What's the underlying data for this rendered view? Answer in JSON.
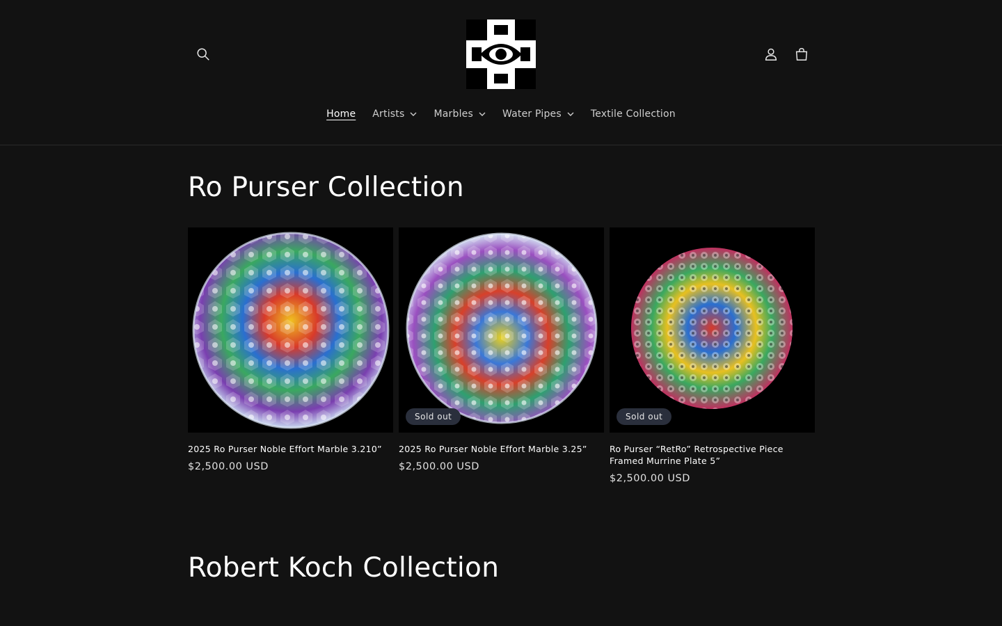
{
  "header": {
    "nav": [
      {
        "label": "Home",
        "active": true,
        "dropdown": false
      },
      {
        "label": "Artists",
        "active": false,
        "dropdown": true
      },
      {
        "label": "Marbles",
        "active": false,
        "dropdown": true
      },
      {
        "label": "Water Pipes",
        "active": false,
        "dropdown": true
      },
      {
        "label": "Textile Collection",
        "active": false,
        "dropdown": false
      }
    ],
    "icons": {
      "search": "search-icon",
      "account": "account-icon",
      "cart": "cart-icon",
      "logo": "eye-logo"
    }
  },
  "sections": [
    {
      "title": "Ro Purser Collection",
      "products": [
        {
          "title": "2025 Ro Purser Noble Effort Marble 3.210”",
          "price": "$2,500.00 USD",
          "sold_out": false,
          "badge": ""
        },
        {
          "title": "2025 Ro Purser Noble Effort Marble 3.25”",
          "price": "$2,500.00 USD",
          "sold_out": true,
          "badge": "Sold out"
        },
        {
          "title": "Ro Purser “RetRo” Retrospective Piece Framed Murrine Plate 5”",
          "price": "$2,500.00 USD",
          "sold_out": true,
          "badge": "Sold out"
        }
      ]
    },
    {
      "title": "Robert Koch Collection",
      "products": []
    }
  ],
  "colors": {
    "background": "#121212",
    "badge": "#2a2f3c",
    "text": "#ffffff"
  }
}
